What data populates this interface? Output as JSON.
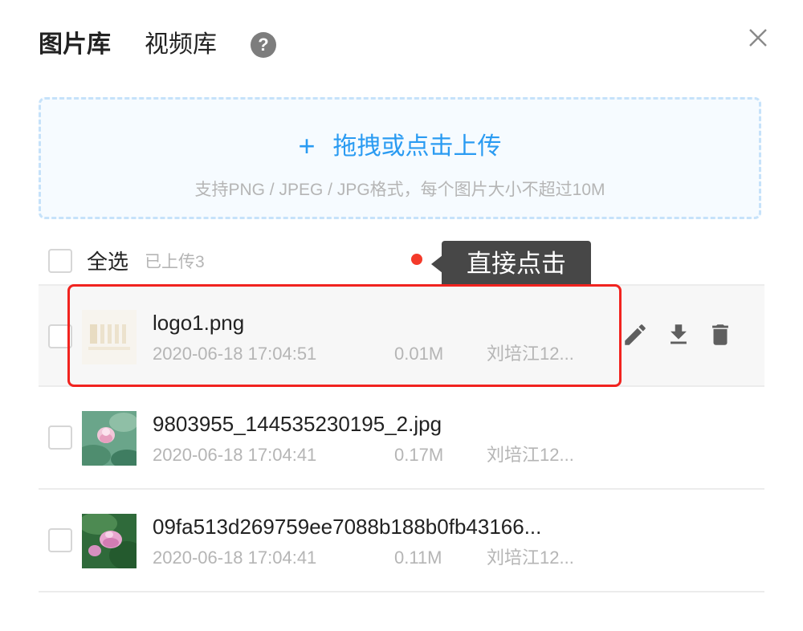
{
  "header": {
    "tabs": [
      {
        "label": "图片库",
        "active": true
      },
      {
        "label": "视频库",
        "active": false
      }
    ],
    "help_icon": "question-circle-icon",
    "help_glyph": "?",
    "close_icon": "close-icon"
  },
  "upload": {
    "plus_glyph": "+",
    "label": "拖拽或点击上传",
    "hint": "支持PNG / JPEG / JPG格式，每个图片大小不超过10M",
    "accent_color": "#2a9bf2"
  },
  "list_header": {
    "select_all_label": "全选",
    "uploaded_count_text": "已上传3"
  },
  "tooltip": {
    "text": "直接点击"
  },
  "files": [
    {
      "name": "logo1.png",
      "date": "2020-06-18 17:04:51",
      "size": "0.01M",
      "uploader": "刘培江12..."
    },
    {
      "name": "9803955_144535230195_2.jpg",
      "date": "2020-06-18 17:04:41",
      "size": "0.17M",
      "uploader": "刘培江12..."
    },
    {
      "name": "09fa513d269759ee7088b188b0fb43166...",
      "date": "2020-06-18 17:04:41",
      "size": "0.11M",
      "uploader": "刘培江12..."
    }
  ],
  "row_actions": [
    {
      "icon": "edit-icon"
    },
    {
      "icon": "download-icon"
    },
    {
      "icon": "delete-icon"
    }
  ],
  "colors": {
    "highlight": "#f1231f",
    "tooltip_bg": "#474747",
    "muted_text": "#b5b5b5"
  }
}
